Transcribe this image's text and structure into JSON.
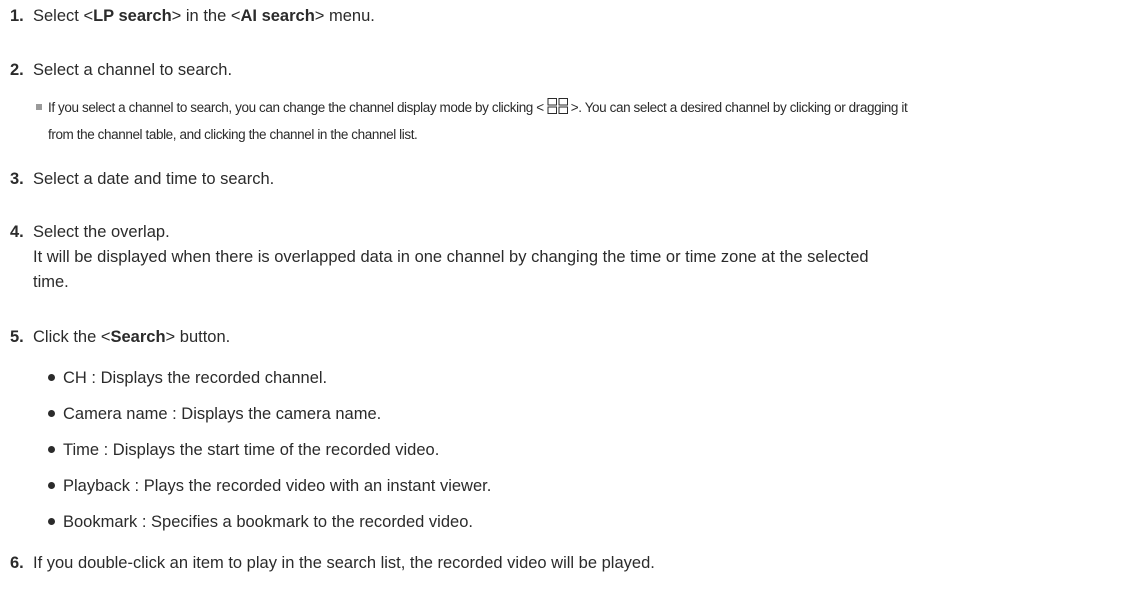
{
  "steps": [
    {
      "num": "1.",
      "pre": "Select <",
      "bold1": "LP search",
      "mid": "> in the <",
      "bold2": "AI search",
      "post": "> menu."
    },
    {
      "num": "2.",
      "text": "Select a channel to search."
    },
    {
      "num": "3.",
      "text": "Select a date and time to search."
    },
    {
      "num": "4.",
      "line1": "Select the overlap.",
      "line2": "It will be displayed when there is overlapped data in one channel by changing the time or time zone at the selected",
      "line3": "time."
    },
    {
      "num": "5.",
      "pre": "Click the <",
      "bold": "Search",
      "post": "> button."
    },
    {
      "num": "6.",
      "text": "If you double-click an item to play in the search list, the recorded video will be played."
    }
  ],
  "note": {
    "pre": "If you select a channel to search, you can change the channel display mode by clicking <",
    "post": ">. You can select a desired channel by clicking or dragging it",
    "line2": "from the channel table, and clicking the channel in the channel list.",
    "icon": "grid-view-icon"
  },
  "bullets": [
    "CH : Displays the recorded channel.",
    "Camera name : Displays the camera name.",
    "Time : Displays the start time of the recorded video.",
    "Playback : Plays the recorded video with an instant viewer.",
    "Bookmark : Specifies a bookmark to the recorded video."
  ],
  "colors": {
    "text": "#2b2b2b",
    "note_marker": "#9a9a9a",
    "background": "#ffffff"
  }
}
